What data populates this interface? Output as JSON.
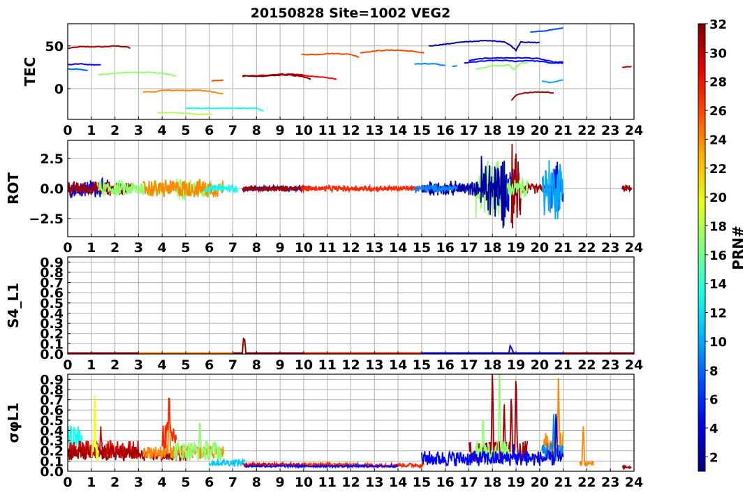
{
  "title": "20150828 Site=1002 VEG2",
  "colorbar": {
    "label": "PRN#",
    "min": 1,
    "max": 32,
    "ticks": [
      2,
      4,
      6,
      8,
      10,
      12,
      14,
      16,
      18,
      20,
      22,
      24,
      26,
      28,
      30,
      32
    ],
    "colormap": "jet"
  },
  "chart_data": [
    {
      "id": "tec",
      "type": "line",
      "ylabel": "TEC",
      "xlim": [
        0,
        24
      ],
      "ylim": [
        -36,
        76
      ],
      "xticks": [
        0,
        1,
        2,
        3,
        4,
        5,
        6,
        7,
        8,
        9,
        10,
        11,
        12,
        13,
        14,
        15,
        16,
        17,
        18,
        19,
        20,
        21,
        22,
        23,
        24
      ],
      "yticks": [
        0,
        50
      ],
      "grid": true,
      "series": [
        {
          "prn": 31,
          "x": [
            0,
            0.5,
            1,
            1.5,
            2,
            2.5,
            2.65
          ],
          "y": [
            47,
            49,
            49,
            49,
            50,
            49,
            47
          ]
        },
        {
          "prn": 5,
          "x": [
            0,
            0.5,
            1,
            1.4
          ],
          "y": [
            28,
            29,
            28,
            28
          ]
        },
        {
          "prn": 8,
          "x": [
            0,
            0.5,
            0.85
          ],
          "y": [
            23,
            23,
            21
          ]
        },
        {
          "prn": 17,
          "x": [
            1.3,
            2,
            2.5,
            3,
            3.5,
            4,
            4.6
          ],
          "y": [
            16,
            18,
            19,
            19,
            19,
            18,
            15
          ]
        },
        {
          "prn": 24,
          "x": [
            3.2,
            3.6,
            4,
            4.5,
            5,
            5.5,
            6,
            6.6
          ],
          "y": [
            -4,
            -4,
            -2,
            -2,
            -2,
            -2,
            -3,
            -6
          ]
        },
        {
          "prn": 26,
          "x": [
            6.1,
            6.6
          ],
          "y": [
            9,
            10
          ]
        },
        {
          "prn": 18,
          "x": [
            3.8,
            4.5,
            5,
            5.5,
            6.1
          ],
          "y": [
            -28,
            -28,
            -29,
            -30,
            -30
          ]
        },
        {
          "prn": 13,
          "x": [
            5,
            5.5,
            6,
            7,
            7.5,
            8,
            8.3
          ],
          "y": [
            -23,
            -23,
            -23,
            -23,
            -23,
            -23,
            -26
          ]
        },
        {
          "prn": 29,
          "x": [
            7.4,
            8,
            8.5,
            9,
            9.5,
            10,
            10.3
          ],
          "y": [
            15,
            15,
            16,
            17,
            17,
            16,
            14
          ]
        },
        {
          "prn": 28,
          "x": [
            9.5,
            10,
            10.5,
            11,
            11.4
          ],
          "y": [
            15,
            15,
            14,
            13,
            11
          ]
        },
        {
          "prn": 32,
          "x": [
            7.4,
            8,
            8.5,
            9,
            9.5,
            10,
            10.3
          ],
          "y": [
            15,
            14,
            15,
            16,
            16,
            14,
            11
          ]
        },
        {
          "prn": 26,
          "x": [
            9.9,
            10.5,
            11,
            11.5,
            12,
            12.35
          ],
          "y": [
            40,
            40,
            41,
            41,
            40,
            37
          ]
        },
        {
          "prn": 26,
          "x": [
            12.4,
            13,
            13.5,
            14,
            14.5,
            15.1
          ],
          "y": [
            42,
            44,
            45,
            45,
            44,
            42
          ]
        },
        {
          "prn": 9,
          "x": [
            14.7,
            15,
            15.5,
            16
          ],
          "y": [
            29,
            29,
            29,
            27
          ]
        },
        {
          "prn": 9,
          "x": [
            16.3,
            16.5
          ],
          "y": [
            26,
            27
          ]
        },
        {
          "prn": 2,
          "x": [
            15.3,
            16,
            16.5,
            17,
            17.5,
            18,
            18.5,
            18.8,
            19,
            19.2,
            19.6,
            20
          ],
          "y": [
            50,
            52,
            54,
            55,
            56,
            56,
            55,
            50,
            45,
            55,
            54,
            54
          ]
        },
        {
          "prn": 17,
          "x": [
            17.3,
            17.6,
            18,
            18.5,
            18.7,
            18.9,
            19.2,
            19.5
          ],
          "y": [
            23,
            24,
            27,
            27,
            28,
            22,
            30,
            30
          ]
        },
        {
          "prn": 4,
          "x": [
            17,
            17.5,
            18,
            18.5,
            19,
            19.5,
            20,
            20.3,
            20.6,
            21
          ],
          "y": [
            33,
            35,
            36,
            36,
            36,
            36,
            35,
            33,
            31,
            31
          ]
        },
        {
          "prn": 5,
          "x": [
            16.8,
            17.5,
            18,
            18.5,
            19,
            19.5,
            20,
            20.5,
            21
          ],
          "y": [
            30,
            32,
            33,
            33,
            32,
            33,
            32,
            30,
            30
          ]
        },
        {
          "prn": 7,
          "x": [
            19.6,
            20,
            20.5,
            21
          ],
          "y": [
            66,
            67,
            69,
            71
          ]
        },
        {
          "prn": 10,
          "x": [
            20.1,
            20.5,
            21
          ],
          "y": [
            9,
            7,
            10
          ]
        },
        {
          "prn": 31,
          "x": [
            18.8,
            19,
            19.3,
            19.8,
            20.3,
            20.6
          ],
          "y": [
            -14,
            -8,
            -5,
            -4,
            -4,
            -5
          ]
        },
        {
          "prn": 30,
          "x": [
            23.5,
            23.9
          ],
          "y": [
            25,
            26
          ]
        }
      ]
    },
    {
      "id": "rot",
      "type": "line",
      "ylabel": "ROT",
      "xlim": [
        0,
        24
      ],
      "ylim": [
        -4,
        4
      ],
      "xticks": [
        0,
        1,
        2,
        3,
        4,
        5,
        6,
        7,
        8,
        9,
        10,
        11,
        12,
        13,
        14,
        15,
        16,
        17,
        18,
        19,
        20,
        21,
        22,
        23,
        24
      ],
      "yticks": [
        -2.5,
        0.0,
        2.5
      ],
      "ytick_labels": [
        "−2.5",
        "0.0",
        "2.5"
      ],
      "grid": true,
      "series": [
        {
          "prn": 5,
          "segments": [
            [
              0,
              1.7,
              0.9
            ],
            [
              7.5,
              10,
              0.25
            ],
            [
              15,
              17,
              0.4
            ],
            [
              18,
              19,
              2.5
            ],
            [
              20.5,
              21,
              2.5
            ]
          ],
          "centers": [
            [
              0.7,
              0.1
            ]
          ]
        },
        {
          "prn": 31,
          "segments": [
            [
              0,
              2.7,
              0.7
            ],
            [
              7.4,
              10.3,
              0.3
            ],
            [
              18.8,
              19.2,
              4
            ],
            [
              19.2,
              20.6,
              0.5
            ],
            [
              23.5,
              23.9,
              0.3
            ]
          ],
          "centers": []
        },
        {
          "prn": 17,
          "segments": [
            [
              1.3,
              4.6,
              0.8
            ],
            [
              4.6,
              6.1,
              1.0
            ],
            [
              17.3,
              18.6,
              2.8
            ],
            [
              18.6,
              19.5,
              1.0
            ]
          ],
          "centers": []
        },
        {
          "prn": 24,
          "segments": [
            [
              3.2,
              6.6,
              0.9
            ]
          ],
          "centers": []
        },
        {
          "prn": 13,
          "segments": [
            [
              5.8,
              7.2,
              0.4
            ]
          ],
          "centers": []
        },
        {
          "prn": 27,
          "segments": [
            [
              9.9,
              15.1,
              0.3
            ]
          ],
          "centers": []
        },
        {
          "prn": 2,
          "segments": [
            [
              15.3,
              17.5,
              0.7
            ],
            [
              17.5,
              18.6,
              3.5
            ]
          ],
          "centers": []
        },
        {
          "prn": 10,
          "segments": [
            [
              20.1,
              21,
              3.0
            ]
          ],
          "centers": []
        },
        {
          "prn": 9,
          "segments": [
            [
              14.7,
              16.5,
              0.4
            ]
          ],
          "centers": []
        }
      ]
    },
    {
      "id": "s4",
      "type": "line",
      "ylabel": "S4_L1",
      "xlim": [
        0,
        24
      ],
      "ylim": [
        0,
        0.95
      ],
      "xticks": [
        0,
        1,
        2,
        3,
        4,
        5,
        6,
        7,
        8,
        9,
        10,
        11,
        12,
        13,
        14,
        15,
        16,
        17,
        18,
        19,
        20,
        21,
        22,
        23,
        24
      ],
      "yticks": [
        0.0,
        0.1,
        0.2,
        0.3,
        0.4,
        0.5,
        0.6,
        0.7,
        0.8,
        0.9
      ],
      "grid": true,
      "series": [
        {
          "prn": 31,
          "x": [
            0,
            7.4,
            7.45,
            7.5,
            7.55,
            24
          ],
          "y": [
            0.01,
            0.01,
            0.15,
            0.14,
            0.01,
            0.01
          ]
        },
        {
          "prn": 5,
          "x": [
            14,
            18.7,
            18.75,
            18.8,
            18.9,
            21
          ],
          "y": [
            0.01,
            0.01,
            0.08,
            0.06,
            0.01,
            0.01
          ]
        },
        {
          "prn": 24,
          "x": [
            3,
            7
          ],
          "y": [
            0.01,
            0.01
          ]
        },
        {
          "prn": 27,
          "x": [
            10,
            15
          ],
          "y": [
            0.01,
            0.01
          ]
        }
      ]
    },
    {
      "id": "sigphi",
      "type": "line",
      "ylabel": "σφL1",
      "xlim": [
        0,
        24
      ],
      "ylim": [
        0,
        0.95
      ],
      "xticks": [
        0,
        1,
        2,
        3,
        4,
        5,
        6,
        7,
        8,
        9,
        10,
        11,
        12,
        13,
        14,
        15,
        16,
        17,
        18,
        19,
        20,
        21,
        22,
        23,
        24
      ],
      "yticks": [
        0.0,
        0.1,
        0.2,
        0.3,
        0.4,
        0.5,
        0.6,
        0.7,
        0.8,
        0.9
      ],
      "grid": true,
      "series": [
        {
          "prn": 13,
          "base": [
            [
              0,
              0.6,
              0.2,
              0.45
            ]
          ],
          "spikes": []
        },
        {
          "prn": 29,
          "base": [
            [
              0,
              3,
              0.12,
              0.3
            ],
            [
              7.4,
              10.3,
              0.05,
              0.08
            ]
          ],
          "spikes": [
            [
              1.4,
              0.32
            ]
          ]
        },
        {
          "prn": 31,
          "base": [
            [
              0,
              3,
              0.1,
              0.25
            ],
            [
              3,
              5,
              0.1,
              0.2
            ],
            [
              17,
              19.5,
              0.1,
              0.3
            ],
            [
              23.5,
              23.9,
              0.03,
              0.05
            ]
          ],
          "spikes": [
            [
              18,
              0.95
            ],
            [
              18.5,
              0.6
            ],
            [
              18.8,
              0.7
            ],
            [
              19,
              0.92
            ]
          ]
        },
        {
          "prn": 20,
          "base": [
            [
              1,
              1.3,
              0.1,
              0.3
            ]
          ],
          "spikes": [
            [
              1.15,
              0.64
            ]
          ]
        },
        {
          "prn": 24,
          "base": [
            [
              3.2,
              6.6,
              0.12,
              0.25
            ],
            [
              10,
              12,
              0.05,
              0.08
            ],
            [
              20.1,
              21,
              0.1,
              0.4
            ],
            [
              21.7,
              22.3,
              0.05,
              0.1
            ]
          ],
          "spikes": [
            [
              4.3,
              0.72
            ],
            [
              20.8,
              0.85
            ],
            [
              21.85,
              0.43
            ]
          ]
        },
        {
          "prn": 27,
          "base": [
            [
              4,
              4.6,
              0.2,
              0.5
            ],
            [
              9.9,
              15.1,
              0.04,
              0.08
            ]
          ],
          "spikes": [
            [
              4.3,
              0.63
            ]
          ]
        },
        {
          "prn": 17,
          "base": [
            [
              4.5,
              6.5,
              0.1,
              0.3
            ],
            [
              17.3,
              18.7,
              0.1,
              0.3
            ]
          ],
          "spikes": [
            [
              5.6,
              0.45
            ],
            [
              18.3,
              0.95
            ],
            [
              17.6,
              0.48
            ]
          ]
        },
        {
          "prn": 11,
          "base": [
            [
              6,
              7.5,
              0.05,
              0.12
            ]
          ],
          "spikes": []
        },
        {
          "prn": 5,
          "base": [
            [
              7.5,
              14,
              0.04,
              0.06
            ],
            [
              15,
              19.5,
              0.05,
              0.2
            ]
          ],
          "spikes": [
            [
              18.9,
              0.22
            ]
          ]
        },
        {
          "prn": 9,
          "base": [
            [
              20.1,
              21,
              0.1,
              0.3
            ]
          ],
          "spikes": [
            [
              20.6,
              0.5
            ]
          ]
        },
        {
          "prn": 4,
          "base": [
            [
              19.5,
              21,
              0.05,
              0.2
            ]
          ],
          "spikes": [
            [
              20.7,
              0.6
            ]
          ]
        }
      ]
    }
  ]
}
